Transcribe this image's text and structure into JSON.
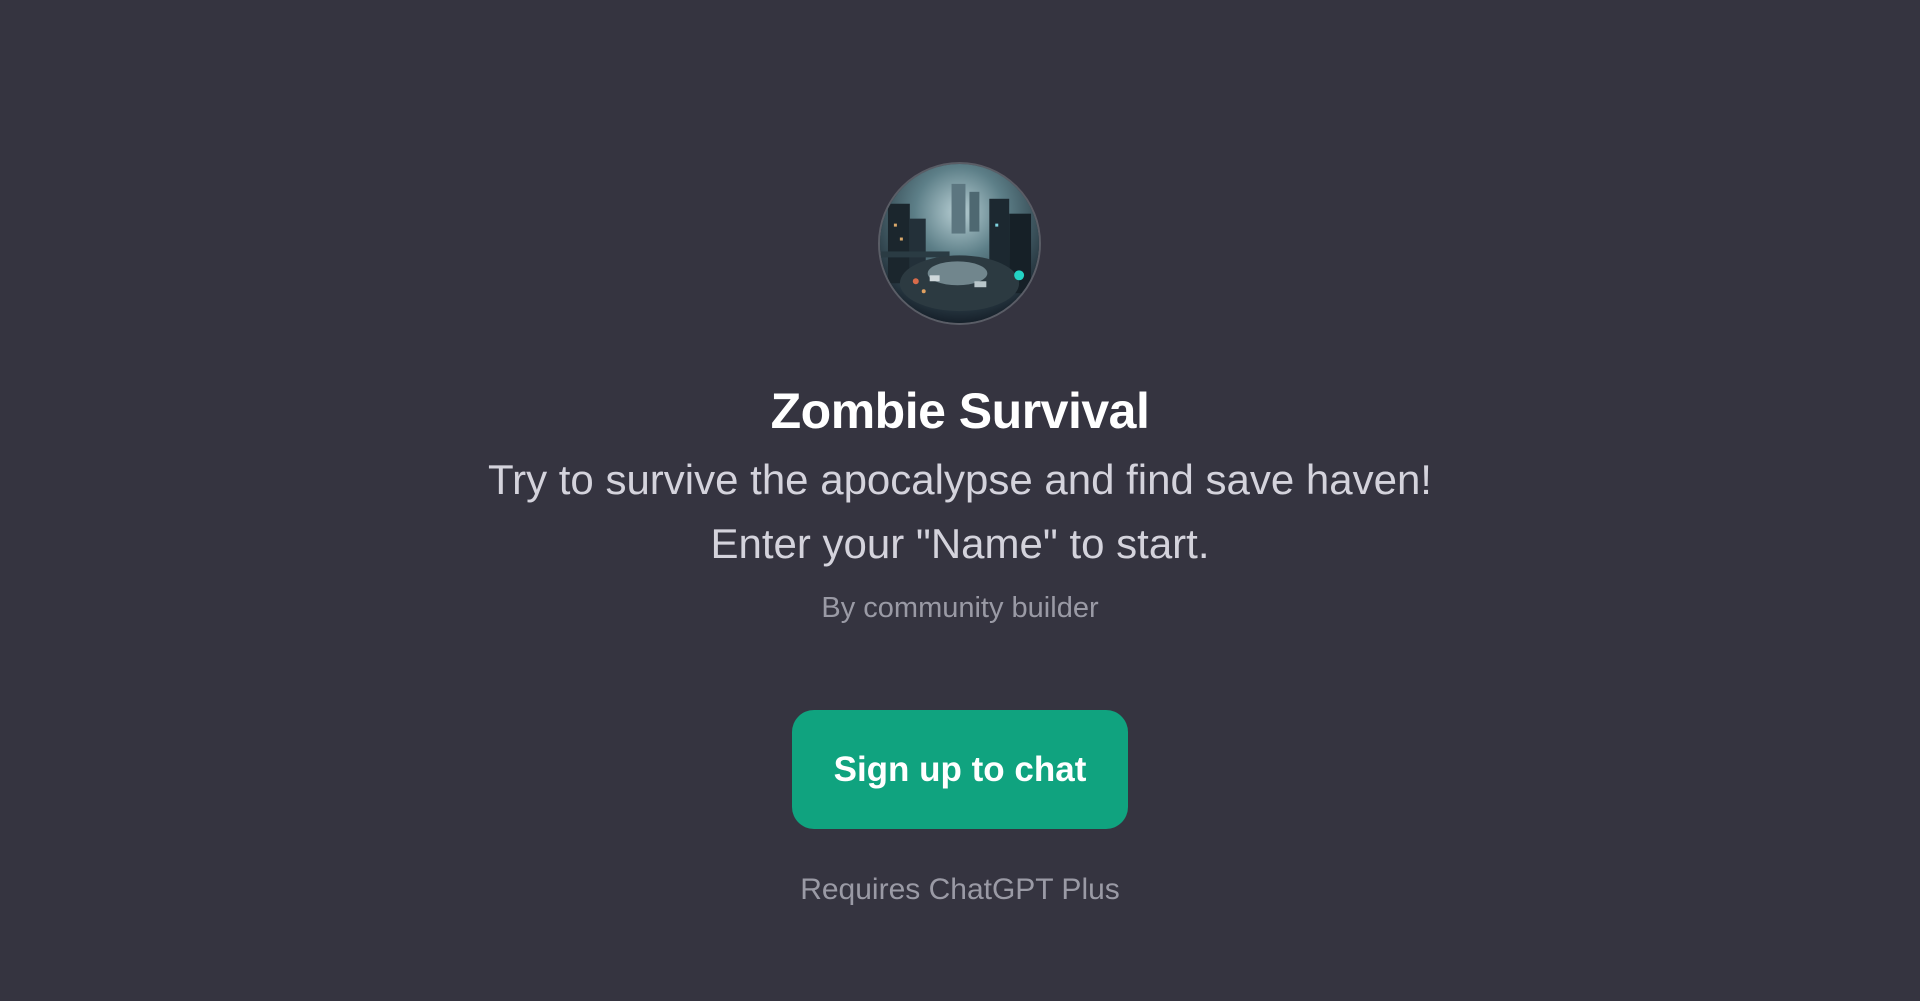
{
  "gpt": {
    "name": "Zombie Survival",
    "description_line1": "Try to survive the apocalypse and find save haven!",
    "description_line2": "Enter your \"Name\" to start.",
    "author": "By community builder",
    "avatar_icon": "zombie-city-avatar"
  },
  "cta": {
    "signup_label": "Sign up to chat",
    "requires_note": "Requires ChatGPT Plus"
  },
  "colors": {
    "background": "#353440",
    "accent": "#10a37f",
    "title": "#ffffff",
    "description": "#d4d3dc",
    "muted": "#9a9aa5"
  }
}
